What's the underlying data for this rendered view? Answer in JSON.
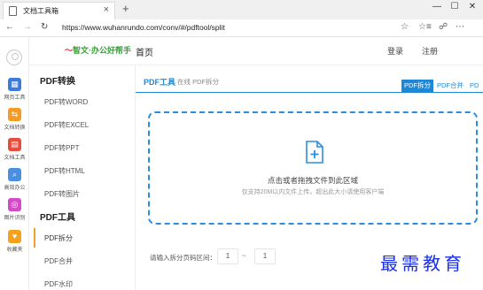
{
  "browser": {
    "tab_title": "文档工具箱",
    "tab_close": "×",
    "new_tab": "+",
    "url": "https://www.wuhanrundo.com/conv/#/pdftool/split",
    "window": {
      "minimize": "—",
      "maximize": "☐",
      "close": "✕"
    },
    "nav": {
      "back": "←",
      "forward": "→",
      "refresh": "↻"
    },
    "tools": {
      "favorite": "☆",
      "favorites": "☆≡",
      "share": "☍",
      "more": "⋯"
    }
  },
  "rail": {
    "items": [
      {
        "label": "网页工具",
        "color": "#3b7bdc",
        "glyph": "▦"
      },
      {
        "label": "文档转换",
        "color": "#f59a23",
        "glyph": "⇆"
      },
      {
        "label": "文档工具",
        "color": "#e84c3d",
        "glyph": "▤"
      },
      {
        "label": "高效办公",
        "color": "#4a90e2",
        "glyph": "⌕"
      },
      {
        "label": "图片识别",
        "color": "#d54ac9",
        "glyph": "◎"
      },
      {
        "label": "收藏夹",
        "color": "#f4a21c",
        "glyph": "♥"
      }
    ]
  },
  "header": {
    "logo": "智文·办公好帮手",
    "home": "首页",
    "login": "登录",
    "register": "注册"
  },
  "sidebar": {
    "sections": [
      {
        "title": "PDF转换",
        "items": [
          "PDF转WORD",
          "PDF转EXCEL",
          "PDF转PPT",
          "PDF转HTML",
          "PDF转图片"
        ]
      },
      {
        "title": "PDF工具",
        "items": [
          "PDF拆分",
          "PDF合并",
          "PDF水印"
        ]
      }
    ]
  },
  "main": {
    "crumb_main": "PDF工具",
    "crumb_sub": "在线 PDF拆分",
    "tool_tabs": [
      "PDF拆分",
      "PDF合并",
      "PD"
    ],
    "active_tab": "PDF拆分",
    "drop_title": "点击或者拖拽文件到此区域",
    "drop_hint": "仅支持20M以内文件上传，超出此大小请使用客户端",
    "range_label": "请输入拆分页码区间：",
    "range_from": "1",
    "range_sep": "~",
    "range_to": "1"
  },
  "watermark": "最需教育",
  "colors": {
    "accent": "#1e88d6",
    "active_bar": "#f0a030",
    "watermark": "#1a2ee6"
  }
}
